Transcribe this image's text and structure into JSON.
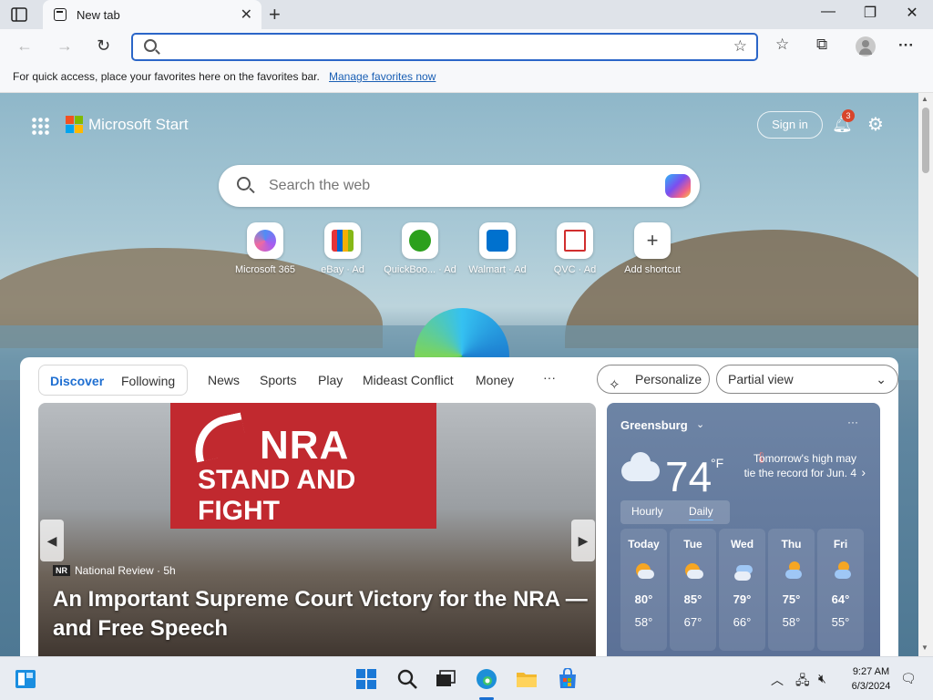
{
  "browser": {
    "tab": {
      "title": "New tab",
      "close": "✕"
    },
    "new_tab": "+",
    "window_controls": {
      "minimize": "—",
      "maximize": "❐",
      "close": "✕"
    },
    "toolbar": {
      "back": "←",
      "forward": "→",
      "refresh": "↻",
      "favorites": "☆",
      "collections": "⧉",
      "more": "···"
    },
    "address_bar": {
      "value": "",
      "placeholder": "",
      "favorite_star": "☆"
    }
  },
  "favorites_bar": {
    "message": "For quick access, place your favorites here on the favorites bar.",
    "link": "Manage favorites now"
  },
  "ntp": {
    "brand": "Microsoft Start",
    "sign_in": "Sign in",
    "notifications_count": "3",
    "search_placeholder": "Search the web",
    "shortcuts": [
      {
        "label": "Microsoft 365",
        "color": "#7a5cf0"
      },
      {
        "label": "eBay · Ad",
        "color": "#e53238"
      },
      {
        "label": "QuickBoo... · Ad",
        "color": "#2ca01c"
      },
      {
        "label": "Walmart · Ad",
        "color": "#0071ce"
      },
      {
        "label": "QVC · Ad",
        "color": "#d12e2e"
      },
      {
        "label": "Add shortcut",
        "color": "#ffffff"
      }
    ]
  },
  "feed": {
    "pivots": [
      "Discover",
      "Following",
      "News",
      "Sports",
      "Play",
      "Mideast Conflict",
      "Money",
      "···"
    ],
    "personalize": "Personalize",
    "view": "Partial view",
    "hero": {
      "banner_line1": "NRA",
      "banner_line2": "STAND AND FIGHT",
      "source_logo": "NR",
      "source": "National Review · 5h",
      "headline": "An Important Supreme Court Victory for the NRA — and Free Speech"
    },
    "weather": {
      "location": "Greensburg",
      "temp": "74",
      "unit": "°F",
      "alert": "Tomorrow's high may tie the record for Jun. 4",
      "tabs": [
        "Hourly",
        "Daily"
      ],
      "days": [
        {
          "name": "Today",
          "hi": "80°",
          "lo": "58°",
          "icon": "partly-sunny-icon"
        },
        {
          "name": "Tue",
          "hi": "85°",
          "lo": "67°",
          "icon": "partly-sunny-icon"
        },
        {
          "name": "Wed",
          "hi": "79°",
          "lo": "66°",
          "icon": "rain-showers-icon"
        },
        {
          "name": "Thu",
          "hi": "75°",
          "lo": "58°",
          "icon": "rain-showers-icon"
        },
        {
          "name": "Fri",
          "hi": "64°",
          "lo": "55°",
          "icon": "rain-showers-icon"
        }
      ]
    }
  },
  "taskbar": {
    "time": "9:27 AM",
    "date": "6/3/2024"
  }
}
